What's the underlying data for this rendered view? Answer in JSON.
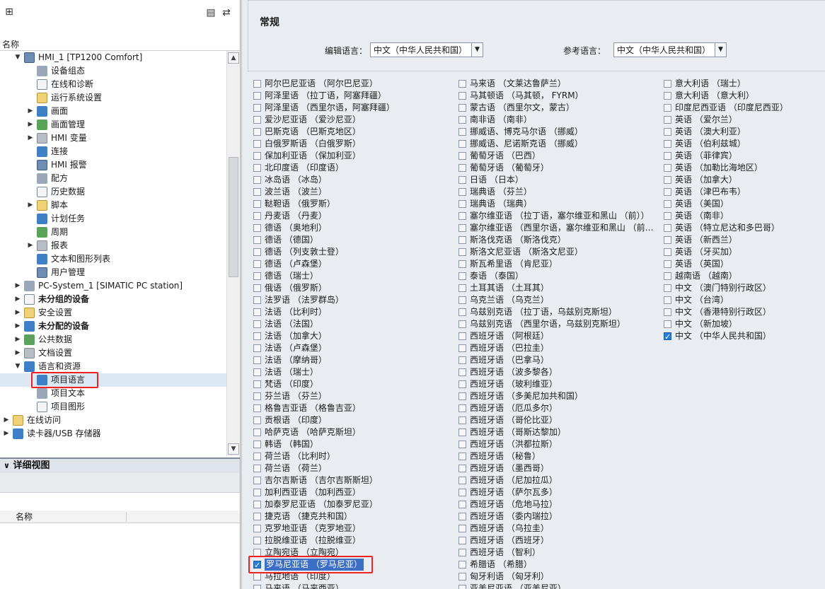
{
  "left": {
    "column_header": "名称",
    "tree": [
      {
        "label": "HMI_1 [TP1200 Comfort]",
        "level": 1,
        "expanded": true,
        "bold": false,
        "icon": "hmi-device-icon"
      },
      {
        "label": "设备组态",
        "level": 2,
        "icon": "device-config-icon"
      },
      {
        "label": "在线和诊断",
        "level": 2,
        "icon": "online-diag-icon"
      },
      {
        "label": "运行系统设置",
        "level": 2,
        "icon": "runtime-settings-icon"
      },
      {
        "label": "画面",
        "level": 2,
        "expandable": true,
        "icon": "screens-folder-icon"
      },
      {
        "label": "画面管理",
        "level": 2,
        "expandable": true,
        "icon": "screen-mgmt-icon"
      },
      {
        "label": "HMI 变量",
        "level": 2,
        "expandable": true,
        "icon": "hmi-tags-icon"
      },
      {
        "label": "连接",
        "level": 2,
        "icon": "connections-icon"
      },
      {
        "label": "HMI 报警",
        "level": 2,
        "icon": "hmi-alarms-icon"
      },
      {
        "label": "配方",
        "level": 2,
        "icon": "recipes-icon"
      },
      {
        "label": "历史数据",
        "level": 2,
        "icon": "historical-data-icon"
      },
      {
        "label": "脚本",
        "level": 2,
        "expandable": true,
        "icon": "scripts-icon"
      },
      {
        "label": "计划任务",
        "level": 2,
        "icon": "scheduled-tasks-icon"
      },
      {
        "label": "周期",
        "level": 2,
        "icon": "cycles-icon"
      },
      {
        "label": "报表",
        "level": 2,
        "expandable": true,
        "icon": "reports-icon"
      },
      {
        "label": "文本和图形列表",
        "level": 2,
        "icon": "text-graphic-lists-icon"
      },
      {
        "label": "用户管理",
        "level": 2,
        "icon": "user-admin-icon"
      },
      {
        "label": "PC-System_1 [SIMATIC PC station]",
        "level": 1,
        "expandable": true,
        "icon": "pc-station-icon"
      },
      {
        "label": "未分组的设备",
        "level": 1,
        "expandable": true,
        "bold": true,
        "icon": "ungrouped-devices-icon"
      },
      {
        "label": "安全设置",
        "level": 1,
        "expandable": true,
        "icon": "security-settings-icon"
      },
      {
        "label": "未分配的设备",
        "level": 1,
        "expandable": true,
        "bold": true,
        "icon": "unassigned-devices-icon"
      },
      {
        "label": "公共数据",
        "level": 1,
        "expandable": true,
        "icon": "common-data-icon"
      },
      {
        "label": "文档设置",
        "level": 1,
        "expandable": true,
        "icon": "doc-settings-icon"
      },
      {
        "label": "语言和资源",
        "level": 1,
        "expanded": true,
        "icon": "languages-resources-icon"
      },
      {
        "label": "项目语言",
        "level": 2,
        "selected": true,
        "icon": "project-languages-icon"
      },
      {
        "label": "项目文本",
        "level": 2,
        "icon": "project-texts-icon"
      },
      {
        "label": "项目图形",
        "level": 2,
        "icon": "project-graphics-icon"
      },
      {
        "label": "在线访问",
        "level": 0,
        "expandable": true,
        "icon": "online-access-icon"
      },
      {
        "label": "读卡器/USB 存储器",
        "level": 0,
        "expandable": true,
        "icon": "card-reader-icon"
      }
    ],
    "detail_title": "详细视图",
    "detail_column": "名称"
  },
  "right": {
    "section_title": "常规",
    "edit_lang_label": "编辑语言：",
    "edit_lang_value": "中文（中华人民共和国）",
    "ref_lang_label": "参考语言：",
    "ref_lang_value": "中文（中华人民共和国）",
    "columns": [
      [
        {
          "t": "阿尔巴尼亚语 （阿尔巴尼亚）",
          "c": false
        },
        {
          "t": "阿泽里语 （拉丁语，阿塞拜疆）",
          "c": false
        },
        {
          "t": "阿泽里语 （西里尔语，阿塞拜疆）",
          "c": false
        },
        {
          "t": "爱沙尼亚语 （爱沙尼亚）",
          "c": false
        },
        {
          "t": "巴斯克语 （巴斯克地区）",
          "c": false
        },
        {
          "t": "白俄罗斯语 （白俄罗斯）",
          "c": false
        },
        {
          "t": "保加利亚语 （保加利亚）",
          "c": false
        },
        {
          "t": "北印度语 （印度语）",
          "c": false
        },
        {
          "t": "冰岛语 （冰岛）",
          "c": false
        },
        {
          "t": "波兰语 （波兰）",
          "c": false
        },
        {
          "t": "鞑靼语 （俄罗斯）",
          "c": false
        },
        {
          "t": "丹麦语 （丹麦）",
          "c": false
        },
        {
          "t": "德语 （奥地利）",
          "c": false
        },
        {
          "t": "德语 （德国）",
          "c": false
        },
        {
          "t": "德语 （列支敦士登）",
          "c": false
        },
        {
          "t": "德语 （卢森堡）",
          "c": false
        },
        {
          "t": "德语 （瑞士）",
          "c": false
        },
        {
          "t": "俄语 （俄罗斯）",
          "c": false
        },
        {
          "t": "法罗语 （法罗群岛）",
          "c": false
        },
        {
          "t": "法语 （比利时）",
          "c": false
        },
        {
          "t": "法语 （法国）",
          "c": false
        },
        {
          "t": "法语 （加拿大）",
          "c": false
        },
        {
          "t": "法语 （卢森堡）",
          "c": false
        },
        {
          "t": "法语 （摩纳哥）",
          "c": false
        },
        {
          "t": "法语 （瑞士）",
          "c": false
        },
        {
          "t": "梵语 （印度）",
          "c": false
        },
        {
          "t": "芬兰语 （芬兰）",
          "c": false
        },
        {
          "t": "格鲁吉亚语 （格鲁吉亚）",
          "c": false
        },
        {
          "t": "贡根语 （印度）",
          "c": false
        },
        {
          "t": "哈萨克语 （哈萨克斯坦）",
          "c": false
        },
        {
          "t": "韩语 （韩国）",
          "c": false
        },
        {
          "t": "荷兰语 （比利时）",
          "c": false
        },
        {
          "t": "荷兰语 （荷兰）",
          "c": false
        },
        {
          "t": "吉尔吉斯语 （吉尔吉斯斯坦）",
          "c": false
        },
        {
          "t": "加利西亚语 （加利西亚）",
          "c": false
        },
        {
          "t": "加泰罗尼亚语 （加泰罗尼亚）",
          "c": false
        },
        {
          "t": "捷克语 （捷克共和国）",
          "c": false
        },
        {
          "t": "克罗地亚语 （克罗地亚）",
          "c": false
        },
        {
          "t": "拉脱维亚语 （拉脱维亚）",
          "c": false
        },
        {
          "t": "立陶宛语 （立陶宛）",
          "c": false
        },
        {
          "t": "罗马尼亚语 （罗马尼亚）",
          "c": true,
          "sel": true
        },
        {
          "t": "马拉地语 （印度）",
          "c": false
        },
        {
          "t": "马来语 （马来西亚）",
          "c": false
        }
      ],
      [
        {
          "t": "马来语 （文莱达鲁萨兰）",
          "c": false
        },
        {
          "t": "马其顿语 （马其顿， FYRM）",
          "c": false
        },
        {
          "t": "蒙古语 （西里尔文，蒙古）",
          "c": false
        },
        {
          "t": "南非语 （南非）",
          "c": false
        },
        {
          "t": "挪威语、博克马尔语 （挪威）",
          "c": false
        },
        {
          "t": "挪威语、尼诺斯克语 （挪威）",
          "c": false
        },
        {
          "t": "葡萄牙语 （巴西）",
          "c": false
        },
        {
          "t": "葡萄牙语 （葡萄牙）",
          "c": false
        },
        {
          "t": "日语 （日本）",
          "c": false
        },
        {
          "t": "瑞典语 （芬兰）",
          "c": false
        },
        {
          "t": "瑞典语 （瑞典）",
          "c": false
        },
        {
          "t": "塞尔维亚语 （拉丁语，塞尔维亚和黑山 （前））",
          "c": false
        },
        {
          "t": "塞尔维亚语 （西里尔语，塞尔维亚和黑山 （前…",
          "c": false
        },
        {
          "t": "斯洛伐克语 （斯洛伐克）",
          "c": false
        },
        {
          "t": "斯洛文尼亚语 （斯洛文尼亚）",
          "c": false
        },
        {
          "t": "斯瓦希里语 （肯尼亚）",
          "c": false
        },
        {
          "t": "泰语 （泰国）",
          "c": false
        },
        {
          "t": "土耳其语 （土耳其）",
          "c": false
        },
        {
          "t": "乌克兰语 （乌克兰）",
          "c": false
        },
        {
          "t": "乌兹别克语 （拉丁语，乌兹别克斯坦）",
          "c": false
        },
        {
          "t": "乌兹别克语 （西里尔语，乌兹别克斯坦）",
          "c": false
        },
        {
          "t": "西班牙语 （阿根廷）",
          "c": false
        },
        {
          "t": "西班牙语 （巴拉圭）",
          "c": false
        },
        {
          "t": "西班牙语 （巴拿马）",
          "c": false
        },
        {
          "t": "西班牙语 （波多黎各）",
          "c": false
        },
        {
          "t": "西班牙语 （玻利维亚）",
          "c": false
        },
        {
          "t": "西班牙语 （多美尼加共和国）",
          "c": false
        },
        {
          "t": "西班牙语 （厄瓜多尔）",
          "c": false
        },
        {
          "t": "西班牙语 （哥伦比亚）",
          "c": false
        },
        {
          "t": "西班牙语 （哥斯达黎加）",
          "c": false
        },
        {
          "t": "西班牙语 （洪都拉斯）",
          "c": false
        },
        {
          "t": "西班牙语 （秘鲁）",
          "c": false
        },
        {
          "t": "西班牙语 （墨西哥）",
          "c": false
        },
        {
          "t": "西班牙语 （尼加拉瓜）",
          "c": false
        },
        {
          "t": "西班牙语 （萨尔瓦多）",
          "c": false
        },
        {
          "t": "西班牙语 （危地马拉）",
          "c": false
        },
        {
          "t": "西班牙语 （委内瑞拉）",
          "c": false
        },
        {
          "t": "西班牙语 （乌拉圭）",
          "c": false
        },
        {
          "t": "西班牙语 （西班牙）",
          "c": false
        },
        {
          "t": "西班牙语 （智利）",
          "c": false
        },
        {
          "t": "希腊语 （希腊）",
          "c": false
        },
        {
          "t": "匈牙利语 （匈牙利）",
          "c": false
        },
        {
          "t": "亚美尼亚语 （亚美尼亚）",
          "c": false
        }
      ],
      [
        {
          "t": "意大利语 （瑞士）",
          "c": false
        },
        {
          "t": "意大利语 （意大利）",
          "c": false
        },
        {
          "t": "印度尼西亚语 （印度尼西亚）",
          "c": false
        },
        {
          "t": "英语 （爱尔兰）",
          "c": false
        },
        {
          "t": "英语 （澳大利亚）",
          "c": false
        },
        {
          "t": "英语 （伯利兹城）",
          "c": false
        },
        {
          "t": "英语 （菲律宾）",
          "c": false
        },
        {
          "t": "英语 （加勒比海地区）",
          "c": false
        },
        {
          "t": "英语 （加拿大）",
          "c": false
        },
        {
          "t": "英语 （津巴布韦）",
          "c": false
        },
        {
          "t": "英语 （美国）",
          "c": false
        },
        {
          "t": "英语 （南非）",
          "c": false
        },
        {
          "t": "英语 （特立尼达和多巴哥）",
          "c": false
        },
        {
          "t": "英语 （新西兰）",
          "c": false
        },
        {
          "t": "英语 （牙买加）",
          "c": false
        },
        {
          "t": "英语 （英国）",
          "c": false
        },
        {
          "t": "越南语 （越南）",
          "c": false
        },
        {
          "t": "中文 （澳门特别行政区）",
          "c": false
        },
        {
          "t": "中文 （台湾）",
          "c": false
        },
        {
          "t": "中文 （香港特别行政区）",
          "c": false
        },
        {
          "t": "中文 （新加坡）",
          "c": false
        },
        {
          "t": "中文 （中华人民共和国）",
          "c": true
        }
      ]
    ]
  }
}
